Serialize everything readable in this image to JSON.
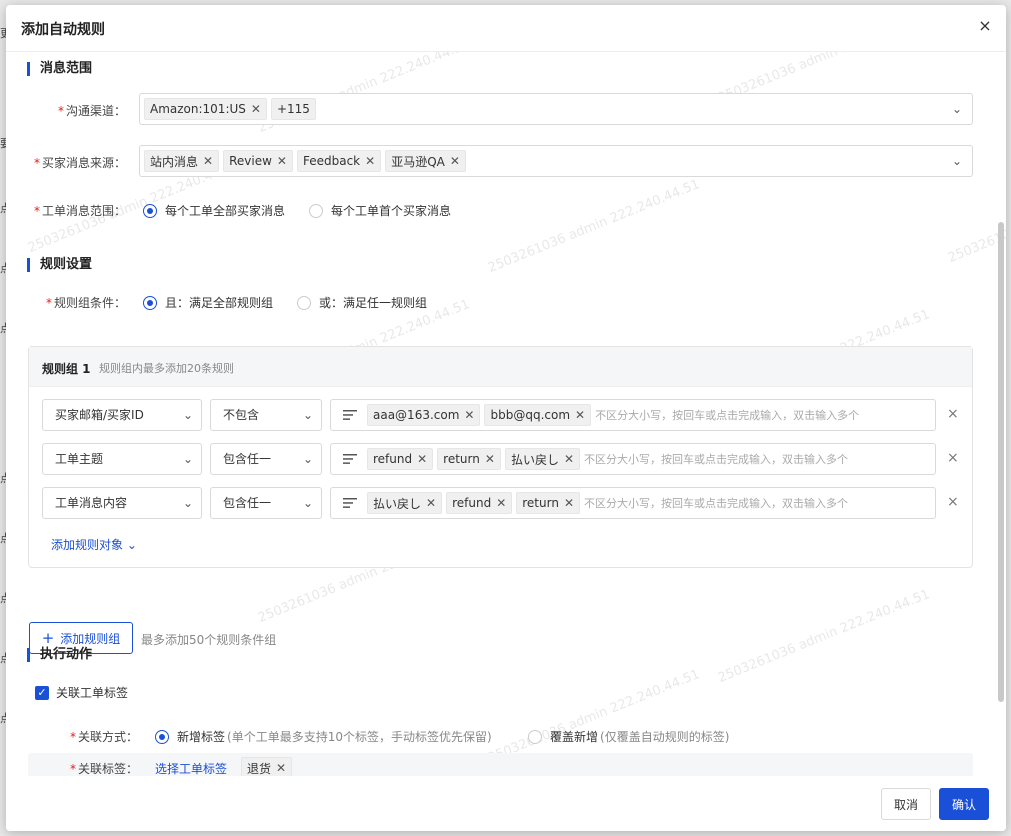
{
  "modal": {
    "title": "添加自动规则",
    "close_symbol": "×"
  },
  "background_fragments": [
    "更",
    "要",
    "点",
    "点",
    "点",
    "点",
    "点",
    "点",
    "点",
    "点"
  ],
  "watermark_text": "2503261036 admin 222.240.44.51",
  "scope": {
    "title": "消息范围",
    "channel": {
      "label": "沟通渠道：",
      "tags": [
        "Amazon:101:US"
      ],
      "more": "+115"
    },
    "source": {
      "label": "买家消息来源：",
      "tags": [
        "站内消息",
        "Review",
        "Feedback",
        "亚马逊QA"
      ]
    },
    "ticket_scope": {
      "label": "工单消息范围：",
      "options": [
        {
          "label": "每个工单全部买家消息",
          "checked": true
        },
        {
          "label": "每个工单首个买家消息",
          "checked": false
        }
      ]
    }
  },
  "rules": {
    "title": "规则设置",
    "group_condition": {
      "label": "规则组条件：",
      "options": [
        {
          "label": "且：满足全部规则组",
          "checked": true
        },
        {
          "label": "或：满足任一规则组",
          "checked": false
        }
      ]
    },
    "group": {
      "title": "规则组 1",
      "hint": "规则组内最多添加20条规则",
      "rows": [
        {
          "field": "买家邮箱/买家ID",
          "operator": "不包含",
          "tags": [
            "aaa@163.com",
            "bbb@qq.com"
          ],
          "placeholder": "不区分大小写，按回车或点击完成输入，双击输入多个"
        },
        {
          "field": "工单主题",
          "operator": "包含任一",
          "tags": [
            "refund",
            "return",
            "払い戻し"
          ],
          "placeholder": "不区分大小写，按回车或点击完成输入，双击输入多个"
        },
        {
          "field": "工单消息内容",
          "operator": "包含任一",
          "tags": [
            "払い戻し",
            "refund",
            "return"
          ],
          "placeholder": "不区分大小写，按回车或点击完成输入，双击输入多个"
        }
      ],
      "add_object": "添加规则对象"
    },
    "add_group_button": "添加规则组",
    "add_group_hint": "最多添加50个规则条件组"
  },
  "actions": {
    "title": "执行动作",
    "link_tag_checkbox": "关联工单标签",
    "link_mode": {
      "label": "关联方式：",
      "options": [
        {
          "label": "新增标签",
          "hint": "(单个工单最多支持10个标签，手动标签优先保留)",
          "checked": true
        },
        {
          "label": "覆盖新增",
          "hint": "(仅覆盖自动规则的标签)",
          "checked": false
        }
      ]
    },
    "link_tags": {
      "label": "关联标签：",
      "select_link": "选择工单标签",
      "tags": [
        "退货"
      ]
    }
  },
  "footer": {
    "cancel": "取消",
    "confirm": "确认"
  },
  "colors": {
    "accent": "#1a4fd8",
    "required": "#e02020"
  }
}
